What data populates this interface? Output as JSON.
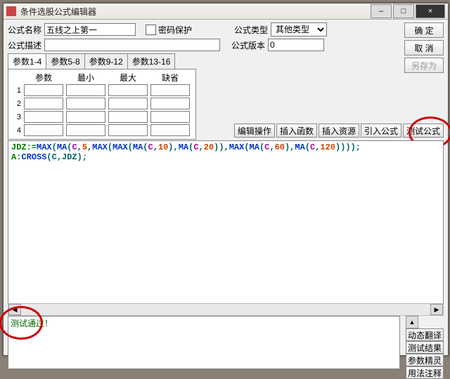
{
  "window": {
    "title": "条件选股公式编辑器",
    "min": "–",
    "max": "□",
    "close": "×"
  },
  "labels": {
    "name": "公式名称",
    "pwd": "密码保护",
    "type": "公式类型",
    "desc": "公式描述",
    "ver": "公式版本"
  },
  "fields": {
    "name": "五线之上第一",
    "desc": "",
    "ver": "0",
    "type_selected": "其他类型"
  },
  "buttons": {
    "ok": "确 定",
    "cancel": "取 消",
    "saveas": "另存为",
    "editop": "编辑操作",
    "insfunc": "插入函数",
    "insres": "插入资源",
    "import": "引入公式",
    "test": "测试公式",
    "dyntrans": "动态翻译",
    "testres": "测试结果",
    "paramwiz": "参数精灵",
    "usage": "用法注释"
  },
  "tabs": [
    "参数1-4",
    "参数5-8",
    "参数9-12",
    "参数13-16"
  ],
  "param_headers": [
    "参数",
    "最小",
    "最大",
    "缺省"
  ],
  "param_rows": [
    1,
    2,
    3,
    4
  ],
  "code": {
    "l1a": "JDZ:=",
    "l1b": "MAX",
    "l1c": "MA",
    "l1d": "C",
    "n5": "5",
    "n10": "10",
    "n20": "20",
    "n60": "60",
    "n120": "120",
    "l2a": "A:",
    "l2b": "CROSS",
    "l2c": "(C,JDZ);"
  },
  "result": "测试通过！",
  "arrows": {
    "left": "◀",
    "right": "▶",
    "up": "▲",
    "down": "▼"
  }
}
